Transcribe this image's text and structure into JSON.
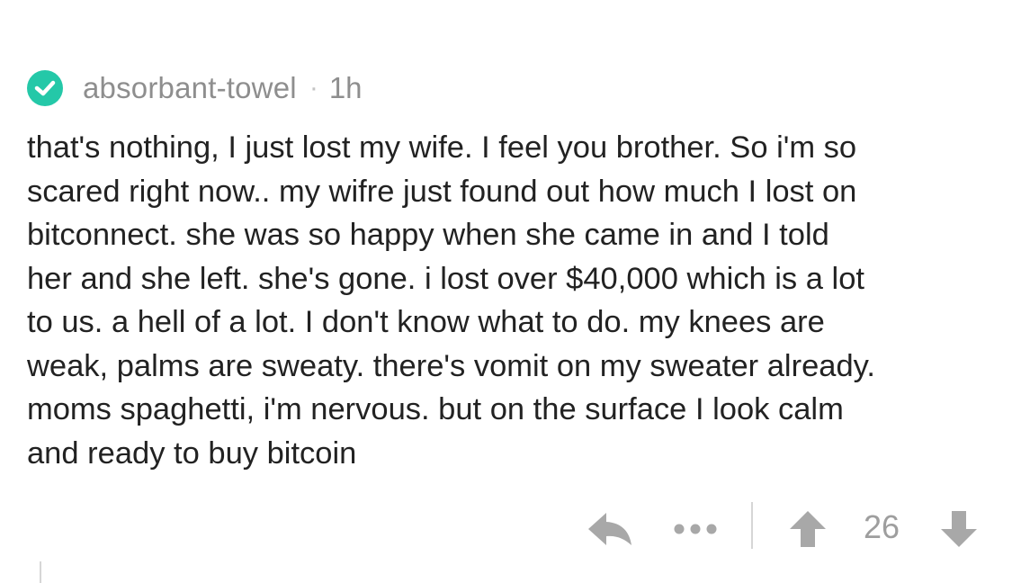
{
  "comment": {
    "author": "absorbant-towel",
    "separator": "·",
    "time": "1h",
    "body": "that's nothing, I just lost my wife. I feel you brother. So i'm so\nscared right now.. my wifre just found out how much I lost on\nbitconnect. she was so happy when she came in and I told\nher and she left. she's gone. i lost over $40,000 which is a lot\nto us. a hell of a lot. I don't know what to do. my knees are\nweak, palms are sweaty. there's vomit on my sweater already.\nmoms spaghetti, i'm nervous. but on the surface I look calm\nand ready to buy bitcoin",
    "score": "26"
  },
  "icons": {
    "badge": "check-icon",
    "reply": "reply-arrow-icon",
    "more": "more-dots-icon",
    "upvote": "upvote-arrow-icon",
    "downvote": "downvote-arrow-icon"
  },
  "colors": {
    "accent": "#24c8a8",
    "meta_text": "#8e8e8e",
    "body_text": "#222222",
    "icon": "#a8a8a8",
    "divider": "#d6d6d6"
  }
}
